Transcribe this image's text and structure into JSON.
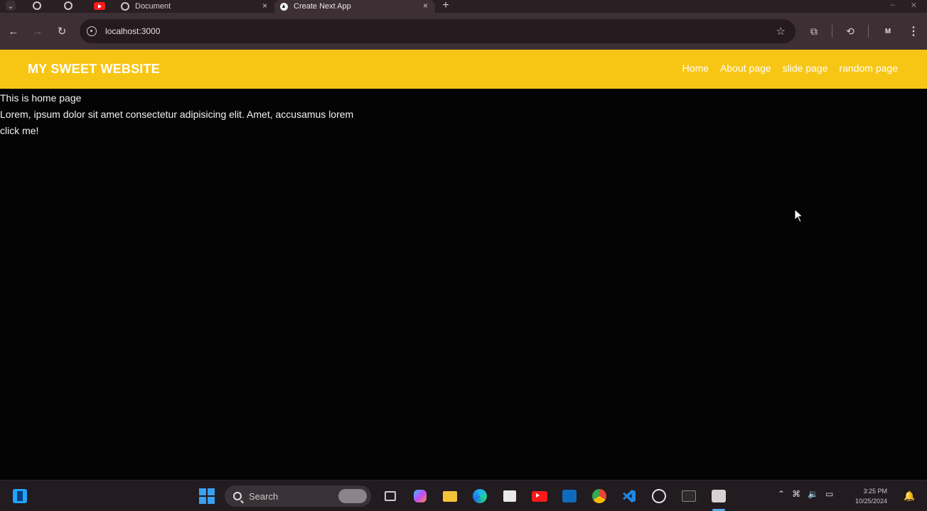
{
  "browser": {
    "tabs": [
      {
        "title": "Document",
        "close": "×"
      },
      {
        "title": "Create Next App",
        "close": "×"
      }
    ],
    "new_tab": "+",
    "tab_list": "⌄",
    "window_controls": {
      "minimize": "–",
      "close": "✕"
    },
    "url": "localhost:3000",
    "profile_initial": "M"
  },
  "site": {
    "brand": "MY SWEET WEBSITE",
    "nav": [
      "Home",
      "About page",
      "slide page",
      "random page"
    ],
    "heading": "This is home page",
    "paragraph": "Lorem, ipsum dolor sit amet consectetur adipisicing elit. Amet, accusamus lorem",
    "button": "click me!"
  },
  "taskbar": {
    "search_placeholder": "Search",
    "clock_time": "3:25 PM",
    "clock_date": "10/25/2024"
  },
  "colors": {
    "header": "#f7c614",
    "page_bg": "#040404",
    "chrome": "#3c3034"
  }
}
